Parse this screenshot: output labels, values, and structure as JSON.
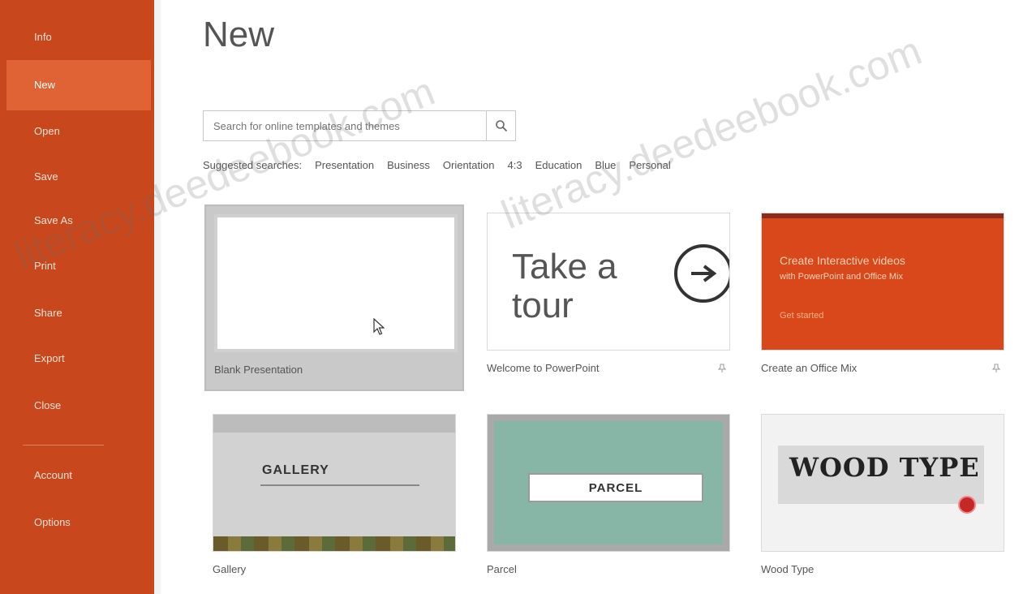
{
  "sidebar": {
    "items": [
      {
        "label": "Info"
      },
      {
        "label": "New"
      },
      {
        "label": "Open"
      },
      {
        "label": "Save"
      },
      {
        "label": "Save As"
      },
      {
        "label": "Print"
      },
      {
        "label": "Share"
      },
      {
        "label": "Export"
      },
      {
        "label": "Close"
      },
      {
        "label": "Account"
      },
      {
        "label": "Options"
      }
    ],
    "active_index": 1,
    "color": "#c8471d",
    "active_color": "#df6335"
  },
  "main": {
    "title": "New",
    "search": {
      "placeholder": "Search for online templates and themes"
    },
    "suggested_label": "Suggested searches:",
    "suggested": [
      "Presentation",
      "Business",
      "Orientation",
      "4:3",
      "Education",
      "Blue",
      "Personal"
    ],
    "templates": [
      {
        "caption": "Blank Presentation",
        "selected": true
      },
      {
        "caption": "Welcome to PowerPoint",
        "thumb_text": "Take a tour",
        "pinned": true
      },
      {
        "caption": "Create an Office Mix",
        "thumb_title": "Create Interactive videos",
        "thumb_sub": "with PowerPoint and Office Mix",
        "thumb_link": "Get started",
        "pinned": true
      },
      {
        "caption": "Gallery",
        "thumb_text": "GALLERY"
      },
      {
        "caption": "Parcel",
        "thumb_text": "PARCEL"
      },
      {
        "caption": "Wood Type",
        "thumb_text": "WOOD TYPE"
      }
    ]
  },
  "watermark": {
    "text_1": "literacy.deedeebook.com",
    "text_2": "literacy.deedeebook.com"
  },
  "icons": {
    "search": "search-icon",
    "pin": "pin-icon",
    "tour": "arrow-right-circle-icon",
    "cursor": "mouse-pointer-icon"
  }
}
